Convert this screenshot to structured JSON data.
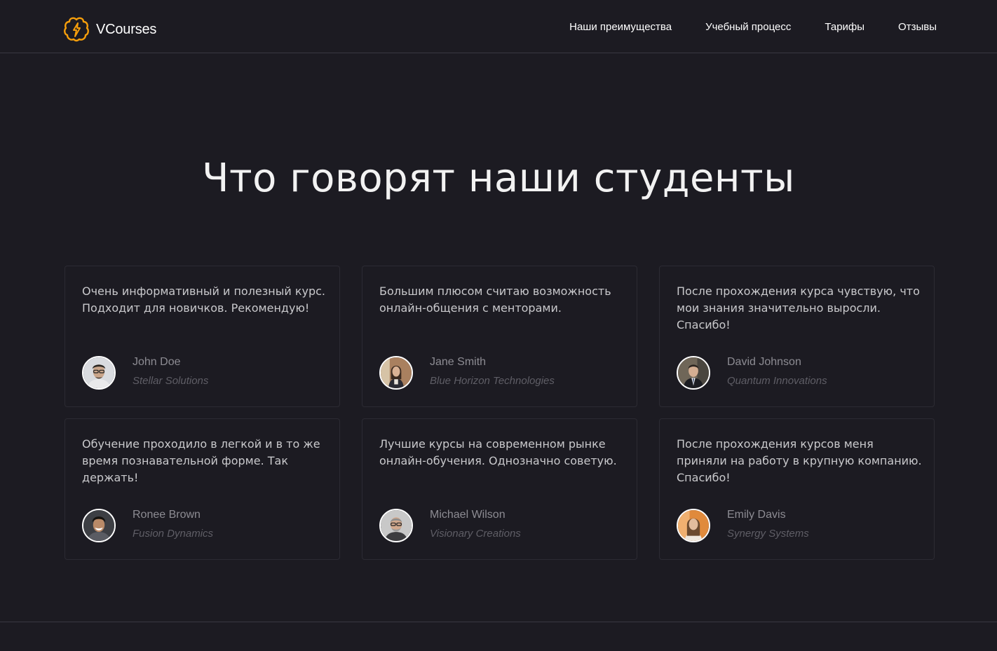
{
  "brand": {
    "name": "VCourses",
    "accent": "#f59e0b"
  },
  "nav": {
    "items": [
      {
        "label": "Наши преимущества"
      },
      {
        "label": "Учебный процесс"
      },
      {
        "label": "Тарифы"
      },
      {
        "label": "Отзывы"
      }
    ]
  },
  "section": {
    "title": "Что говорят наши студенты"
  },
  "testimonials": [
    {
      "text": "Очень информативный и полезный курс. Подходит для новичков. Рекомендую!",
      "name": "John Doe",
      "company": "Stellar Solutions"
    },
    {
      "text": "Большим плюсом считаю возможность онлайн-общения с менторами.",
      "name": "Jane Smith",
      "company": "Blue Horizon Technologies"
    },
    {
      "text": "После прохождения курса чувствую, что мои знания значительно выросли. Спасибо!",
      "name": "David Johnson",
      "company": "Quantum Innovations"
    },
    {
      "text": "Обучение проходило в легкой и в то же время познавательной форме. Так держать!",
      "name": "Ronee Brown",
      "company": "Fusion Dynamics"
    },
    {
      "text": "Лучшие курсы на современном рынке онлайн-обучения. Однозначно советую.",
      "name": "Michael Wilson",
      "company": "Visionary Creations"
    },
    {
      "text": "После прохождения курсов меня приняли на работу в крупную компанию. Спасибо!",
      "name": "Emily Davis",
      "company": "Synergy Systems"
    }
  ]
}
